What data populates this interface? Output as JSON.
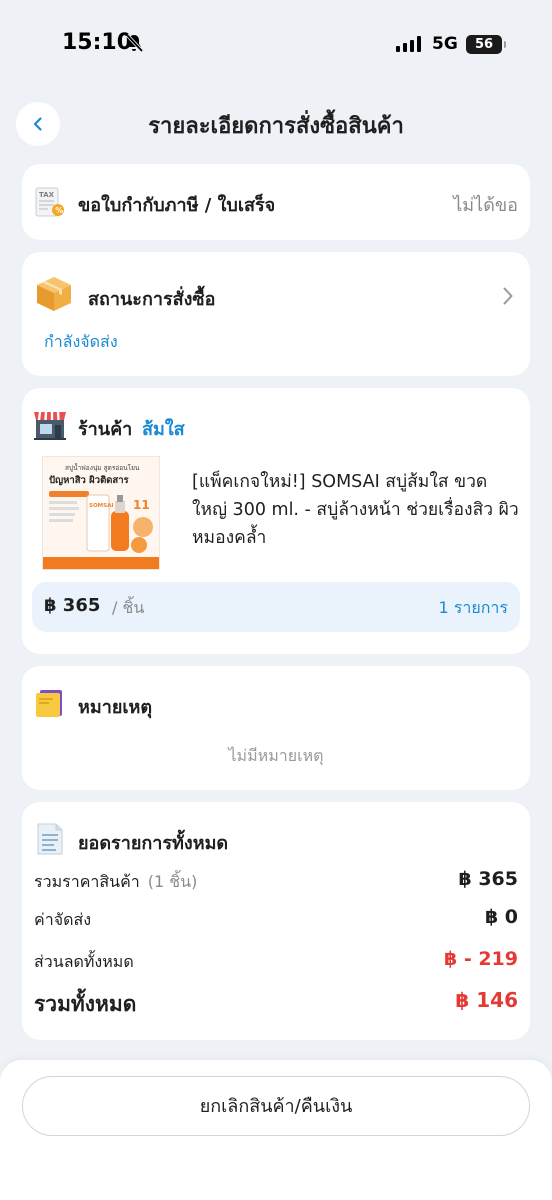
{
  "status_bar": {
    "time": "15:10",
    "network": "5G",
    "battery": "56"
  },
  "header": {
    "title": "รายละเอียดการสั่งซื้อสินค้า"
  },
  "tax_invoice": {
    "label": "ขอใบกำกับภาษี / ใบเสร็จ",
    "value": "ไม่ได้ขอ",
    "icon_text": "TAX"
  },
  "order_status": {
    "label": "สถานะการสั่งซื้อ",
    "value": "กำลังจัดส่ง"
  },
  "shop": {
    "label": "ร้านค้า",
    "name": "ส้มใส",
    "product": {
      "title": "[แพ็คเกจใหม่!] SOMSAI สบู่ส้มใส ขวดใหญ่ 300 ml. - สบู่ล้างหน้า ช่วยเรื่องสิว ผิวหมองคล้ำ",
      "image_heading": "สบู่น้ำฟองนุ่ม สูตรอ่อนโยน",
      "image_line1": "ปัญหาสิว ผิวติดสาร",
      "image_brand": "SOMSAI",
      "image_number": "11"
    },
    "price": "฿ 365",
    "price_unit": "/ ชิ้น",
    "item_count": "1 รายการ"
  },
  "note": {
    "label": "หมายเหตุ",
    "empty_text": "ไม่มีหมายเหตุ"
  },
  "summary": {
    "label": "ยอดรายการทั้งหมด",
    "subtotal_label": "รวมราคาสินค้า",
    "subtotal_qty": "(1 ชิ้น)",
    "subtotal_value": "฿ 365",
    "shipping_label": "ค่าจัดส่ง",
    "shipping_value": "฿ 0",
    "discount_label": "ส่วนลดทั้งหมด",
    "discount_value": "฿ - 219",
    "total_label": "รวมทั้งหมด",
    "total_value": "฿ 146"
  },
  "actions": {
    "cancel_label": "ยกเลิกสินค้า/คืนเงิน"
  },
  "colors": {
    "accent": "#1a8ad4",
    "danger": "#e53935",
    "background": "#eef2f7"
  }
}
